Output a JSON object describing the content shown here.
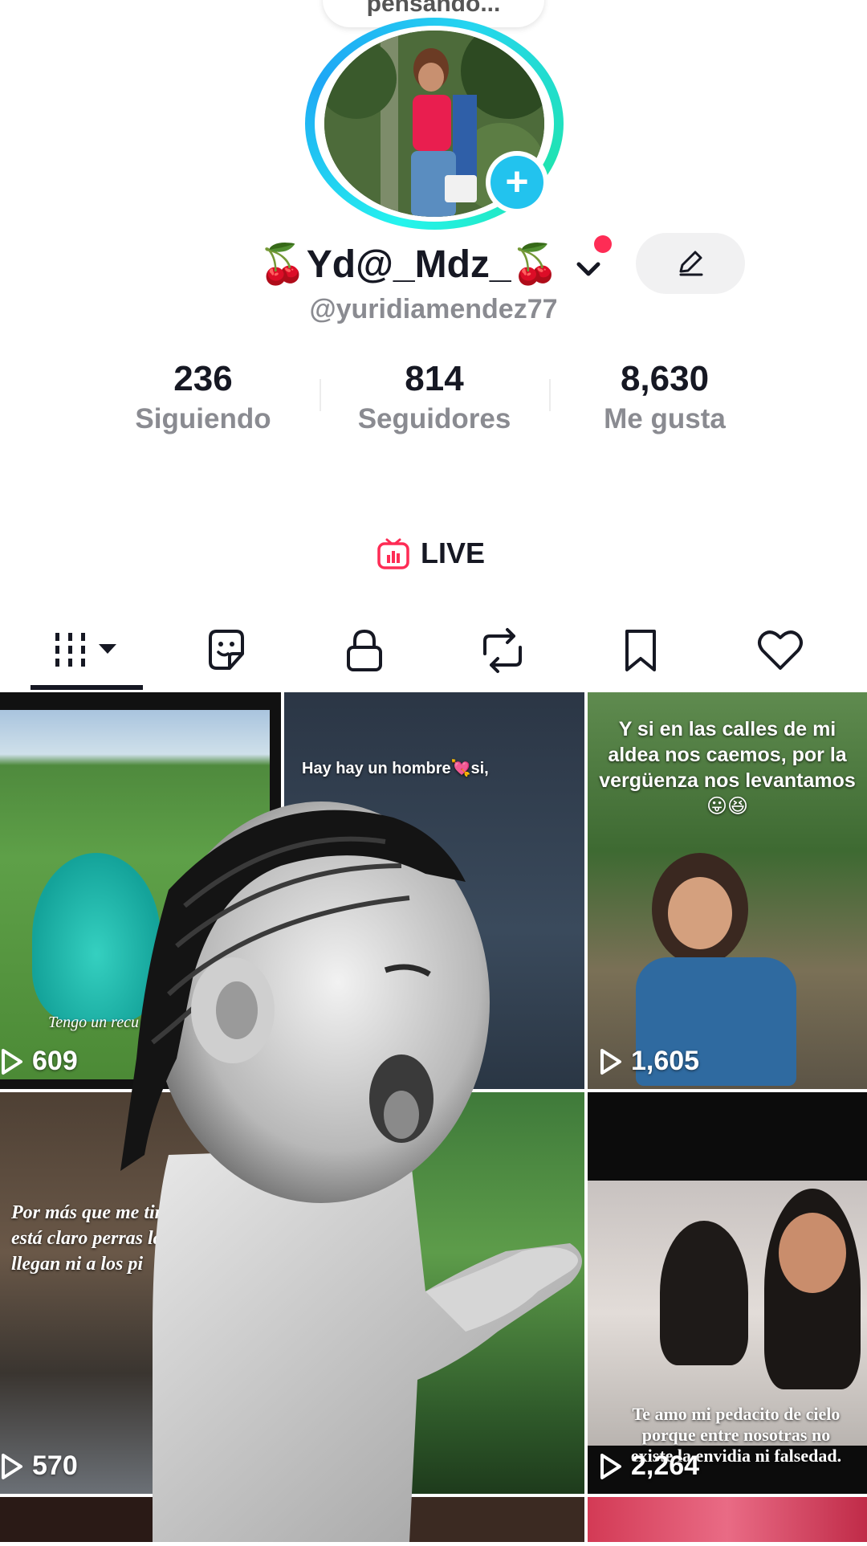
{
  "status_bubble": {
    "text": "pensando..."
  },
  "profile": {
    "display_name": "🍒Yd@_Mdz_🍒",
    "username": "@yuridiamendez77"
  },
  "stats": [
    {
      "value": "236",
      "label": "Siguiendo"
    },
    {
      "value": "814",
      "label": "Seguidores"
    },
    {
      "value": "8,630",
      "label": "Me gusta"
    }
  ],
  "live": {
    "label": "LIVE"
  },
  "tabs": [
    {
      "name": "videos",
      "icon": "grid-icon"
    },
    {
      "name": "stickers",
      "icon": "sticker-icon"
    },
    {
      "name": "private",
      "icon": "lock-icon"
    },
    {
      "name": "reposts",
      "icon": "repost-icon"
    },
    {
      "name": "favorites",
      "icon": "bookmark-icon"
    },
    {
      "name": "liked",
      "icon": "heart-icon"
    }
  ],
  "videos": [
    {
      "views": "609",
      "caption": "Tengo un recu"
    },
    {
      "views": "",
      "caption": "Hay hay un hombre💘si,"
    },
    {
      "views": "1,605",
      "caption": "Y si en las calles de mi aldea nos caemos, por la vergüenza nos levantamos 😛😆"
    },
    {
      "views": "570",
      "caption": "Por más que me tire envidias, está claro perras ladran, n llegan ni a los pi"
    },
    {
      "views": "",
      "caption": ""
    },
    {
      "views": "2,264",
      "caption": "Te amo mi pedacito de cielo porque entre nosotras no existe la envidia ni falsedad."
    }
  ],
  "colors": {
    "accent": "#fe2c55",
    "ring_blue": "#1ea7f5",
    "ring_teal": "#25f4ee",
    "plus_blue": "#22c3ee"
  }
}
